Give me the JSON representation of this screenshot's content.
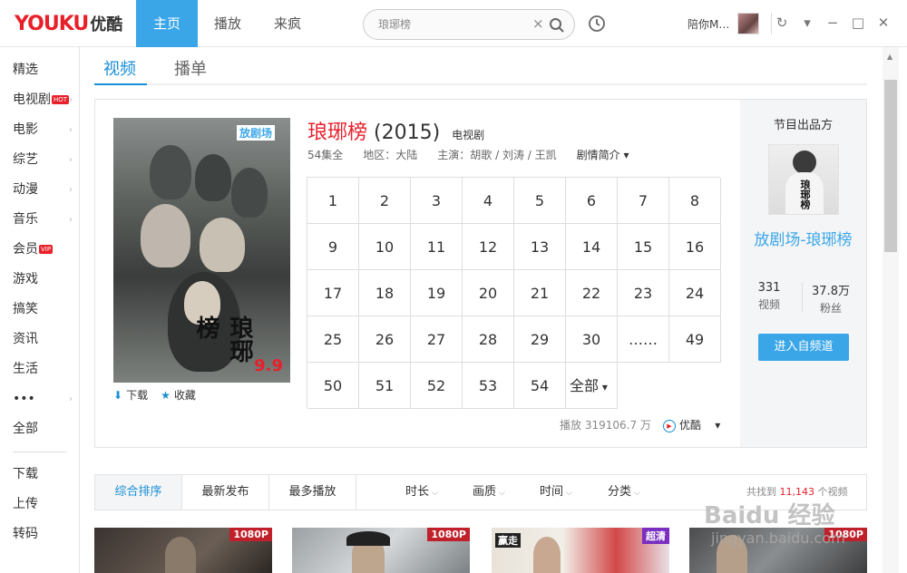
{
  "header": {
    "logo_en": "YOUKU",
    "logo_cn": "优酷",
    "nav": [
      "主页",
      "播放",
      "来疯"
    ],
    "search_value": "琅琊榜",
    "clear_symbol": "×",
    "username": "陪你M…"
  },
  "sidebar": {
    "items": [
      {
        "label": "精选"
      },
      {
        "label": "电视剧",
        "badge": "HOT"
      },
      {
        "label": "电影"
      },
      {
        "label": "综艺"
      },
      {
        "label": "动漫"
      },
      {
        "label": "音乐"
      },
      {
        "label": "会员",
        "badge": "VIP"
      },
      {
        "label": "游戏"
      },
      {
        "label": "搞笑"
      },
      {
        "label": "资讯"
      },
      {
        "label": "生活"
      },
      {
        "label": "•••"
      },
      {
        "label": "全部"
      }
    ],
    "bottom": [
      "下载",
      "上传",
      "转码"
    ]
  },
  "tabs": [
    "视频",
    "播单"
  ],
  "show": {
    "title": "琅琊榜",
    "year": "(2015)",
    "type": "电视剧",
    "episodes_count": "54集全",
    "region": "地区：大陆",
    "cast": "主演：胡歌 / 刘涛 / 王凯",
    "intro_label": "剧情简介",
    "poster_rating": "9.9",
    "poster_brand": "放剧场",
    "poster_calligraphy": "琅琊榜",
    "download_label": "下载",
    "favorite_label": "收藏",
    "play_count": "播放 319106.7 万",
    "source": "优酷"
  },
  "episodes": [
    "1",
    "2",
    "3",
    "4",
    "5",
    "6",
    "7",
    "8",
    "9",
    "10",
    "11",
    "12",
    "13",
    "14",
    "15",
    "16",
    "17",
    "18",
    "19",
    "20",
    "21",
    "22",
    "23",
    "24",
    "25",
    "26",
    "27",
    "28",
    "29",
    "30",
    "……",
    "49",
    "50",
    "51",
    "52",
    "53",
    "54",
    "全部"
  ],
  "channel": {
    "heading": "节目出品方",
    "name": "放剧场-琅琊榜",
    "videos_count": "331",
    "videos_label": "视频",
    "fans_count": "37.8万",
    "fans_label": "粉丝",
    "enter_label": "进入自频道",
    "image_text": "琅琊榜"
  },
  "sortbar": {
    "sorts": [
      "综合排序",
      "最新发布",
      "最多播放"
    ],
    "filters": [
      "时长",
      "画质",
      "时间",
      "分类"
    ],
    "total_prefix": "共找到",
    "total_count": "11,143",
    "total_suffix": "个视频"
  },
  "thumbnails": [
    {
      "tag": "1080P",
      "tag_color": "#c0202a"
    },
    {
      "tag": "1080P",
      "tag_color": "#c0202a"
    },
    {
      "tag": "超清",
      "tag_color": "#7a2fc0",
      "caption": "赢走"
    },
    {
      "tag": "1080P",
      "tag_color": "#c0202a"
    }
  ],
  "watermark": {
    "line1": "Baidu 经验",
    "line2": "jingyan.baidu.com"
  },
  "colors": {
    "accent": "#3aa6e8",
    "brand_red": "#e8202a",
    "link_blue": "#1a8fd6"
  }
}
